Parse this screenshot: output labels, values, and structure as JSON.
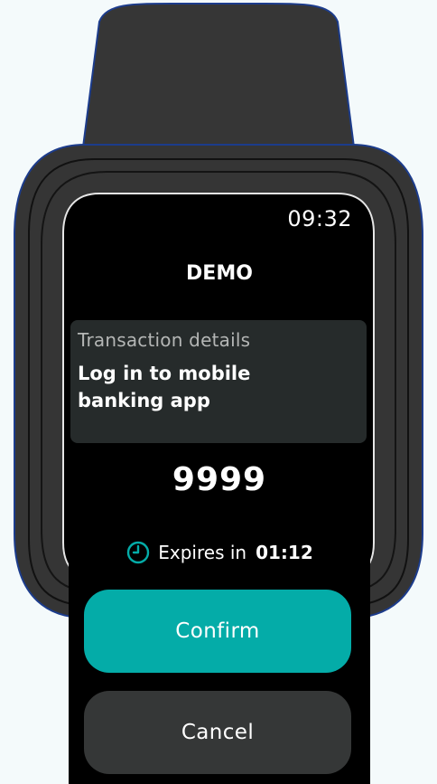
{
  "device": {
    "status_time": "09:32"
  },
  "app": {
    "title": "DEMO"
  },
  "details": {
    "label": "Transaction details",
    "text": "Log in to mobile banking app"
  },
  "code": "9999",
  "expiry": {
    "label": "Expires in",
    "value": "01:12",
    "icon": "clock-icon"
  },
  "actions": {
    "confirm_label": "Confirm",
    "cancel_label": "Cancel"
  },
  "colors": {
    "accent": "#04aca8",
    "secondary_button": "#353737",
    "card": "#262b2b",
    "watch_body": "#353535",
    "background": "#f4fafb"
  }
}
